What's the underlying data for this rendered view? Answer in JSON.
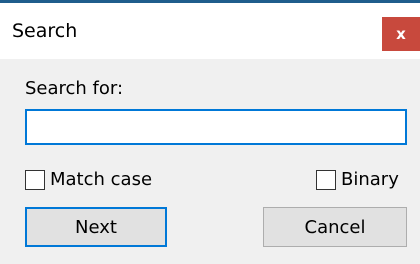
{
  "dialog": {
    "title": "Search",
    "close_label": "x"
  },
  "form": {
    "search_label": "Search for:",
    "search_value": "",
    "match_case_label": "Match case",
    "match_case_checked": false,
    "binary_label": "Binary",
    "binary_checked": false,
    "next_label": "Next",
    "cancel_label": "Cancel"
  },
  "colors": {
    "close_button": "#c8493d",
    "focus_border": "#0078d7",
    "dialog_background": "#f0f0f0",
    "button_background": "#e1e1e1"
  }
}
